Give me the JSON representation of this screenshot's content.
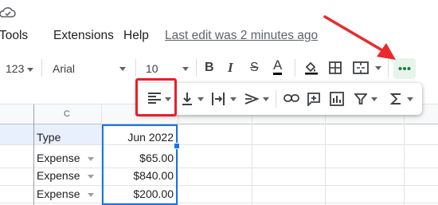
{
  "menu": {
    "items": [
      "Tools",
      "Extensions",
      "Help"
    ],
    "last_edit": "Last edit was 2 minutes ago"
  },
  "toolbar": {
    "number_format": "123",
    "font": "Arial",
    "font_size": "10",
    "bold": "B",
    "italic": "I",
    "strike": "S",
    "text_color": "A",
    "more_label": "•••"
  },
  "grid": {
    "column_header": "C",
    "header_type": "Type",
    "header_date": "Jun 2022",
    "rows": [
      {
        "type": "Expense",
        "amount": "$65.00"
      },
      {
        "type": "Expense",
        "amount": "$840.00"
      },
      {
        "type": "Expense",
        "amount": "$200.00"
      }
    ]
  },
  "colors": {
    "accent": "#1a73e8",
    "highlight_red": "#e8202a",
    "more_button_bg": "#e6f4ea",
    "header_band": "#e8f0fe"
  },
  "icons": [
    "cloud-icon",
    "paint-format-icon",
    "borders-icon",
    "merge-cells-icon",
    "more-icon",
    "horizontal-align-icon",
    "vertical-align-icon",
    "text-wrap-icon",
    "text-rotation-icon",
    "insert-link-icon",
    "insert-comment-icon",
    "insert-chart-icon",
    "filter-icon",
    "functions-icon"
  ]
}
